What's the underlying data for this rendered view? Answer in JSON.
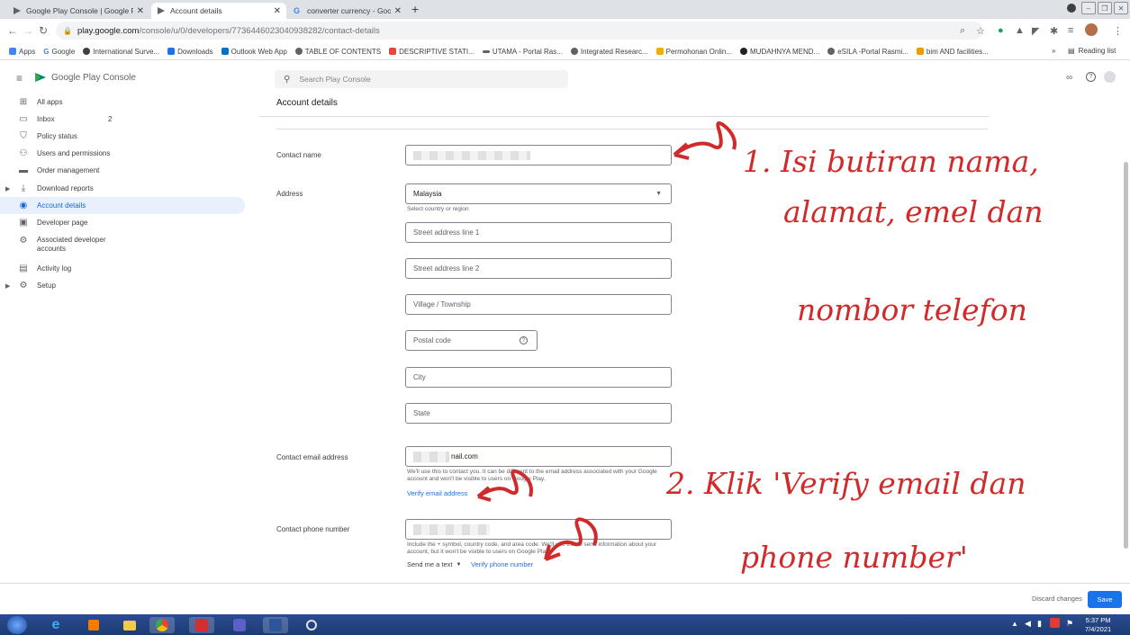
{
  "browser": {
    "tabs": [
      {
        "label": "Google Play Console | Google Pl",
        "active": false
      },
      {
        "label": "Account details",
        "active": true
      },
      {
        "label": "converter currency - Google Sea",
        "active": false
      }
    ],
    "url_host": "play.google.com",
    "url_path": "/console/u/0/developers/7736446023040938282/contact-details",
    "bookmarks": [
      "Apps",
      "Google",
      "International Surve...",
      "Downloads",
      "Outlook Web App",
      "TABLE OF CONTENTS",
      "DESCRIPTIVE STATI...",
      "UTAMA - Portal Ras...",
      "Integrated Researc...",
      "Permohonan Onlin...",
      "MUDAHNYA MEND...",
      "eSILA -Portal Rasmi...",
      "bim AND facilities..."
    ],
    "reading_list": "Reading list"
  },
  "app": {
    "logo_text": "Google Play Console",
    "search_placeholder": "Search Play Console"
  },
  "sidebar": {
    "items": [
      {
        "label": "All apps",
        "icon": "grid-icon"
      },
      {
        "label": "Inbox",
        "icon": "inbox-icon",
        "badge": "2"
      },
      {
        "label": "Policy status",
        "icon": "shield-icon"
      },
      {
        "label": "Users and permissions",
        "icon": "users-icon"
      },
      {
        "label": "Order management",
        "icon": "card-icon"
      },
      {
        "label": "Download reports",
        "icon": "download-icon"
      },
      {
        "label": "Account details",
        "icon": "account-icon",
        "active": true
      },
      {
        "label": "Developer page",
        "icon": "page-icon"
      },
      {
        "label": "Associated developer",
        "label2": "accounts",
        "icon": "link-icon"
      },
      {
        "label": "Activity log",
        "icon": "log-icon"
      },
      {
        "label": "Setup",
        "icon": "gear-icon"
      }
    ]
  },
  "main": {
    "title": "Account details",
    "contact_name_label": "Contact name",
    "address_label": "Address",
    "country_value": "Malaysia",
    "country_hint": "Select country or region",
    "street1_placeholder": "Street address line 1",
    "street2_placeholder": "Street address line 2",
    "village_placeholder": "Village / Township",
    "postal_placeholder": "Postal code",
    "city_placeholder": "City",
    "state_placeholder": "State",
    "email_label": "Contact email address",
    "email_value_visible": "nail.com",
    "email_hint": "We'll use this to contact you. It can be different to the email address associated with your Google account and won't be visible to users on Google Play.",
    "verify_email": "Verify email address",
    "phone_label": "Contact phone number",
    "phone_hint": "Include the + symbol, country code, and area code. We'll use this to send information about your account, but it won't be visible to users on Google Play.",
    "send_text": "Send me a text",
    "verify_phone": "Verify phone number"
  },
  "annotations": {
    "step1_line1": "1. Isi butiran nama,",
    "step1_line2": "alamat, emel dan",
    "step1_line3": "nombor telefon",
    "step2_line1": "2. Klik 'Verify email dan",
    "step2_line2": "phone number'"
  },
  "footer": {
    "discard": "Discard changes",
    "save": "Save"
  },
  "taskbar": {
    "time": "5:37 PM",
    "date": "7/4/2021"
  }
}
